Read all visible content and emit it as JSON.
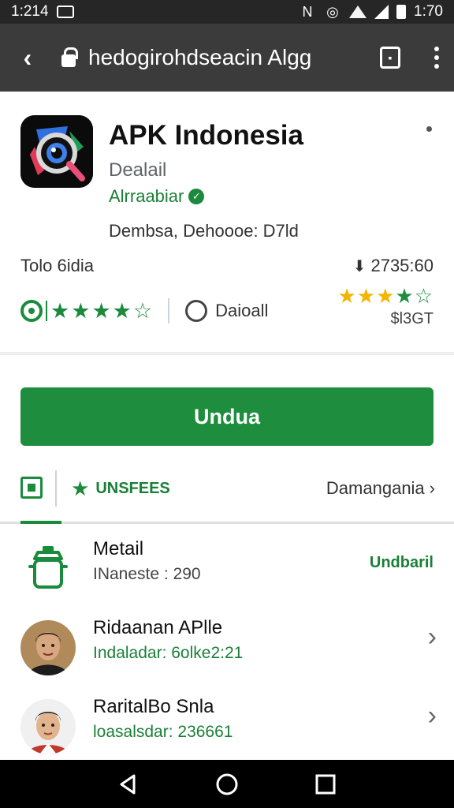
{
  "status": {
    "time_left": "1:214",
    "time_right": "1:70"
  },
  "browser": {
    "url": "hedogirohdseacin Algg"
  },
  "app": {
    "title": "APK Indonesia",
    "subtitle": "Dealail",
    "developer": "Alrraabiar",
    "meta": "Dembsa, Dehoooe: D7ld",
    "left_label": "Tolo 6idia",
    "right_count": "2735:60",
    "rating_label": "Daioall",
    "price": "$l3GT",
    "accent_color": "#1e8e3e"
  },
  "install": {
    "label": "Undua"
  },
  "tabs": {
    "middle_label": "UNSFEES",
    "right_label": "Damangania"
  },
  "list": [
    {
      "title": "Metail",
      "subtitle": "INaneste : 290",
      "action": "Undbaril",
      "icon": "bottle-icon"
    },
    {
      "title": "Ridaanan APlle",
      "subtitle": "Indaladar: 6olke2:21",
      "icon": "avatar"
    },
    {
      "title": "RaritalBo Snla",
      "subtitle": "loasalsdar: 236661",
      "icon": "avatar"
    }
  ]
}
